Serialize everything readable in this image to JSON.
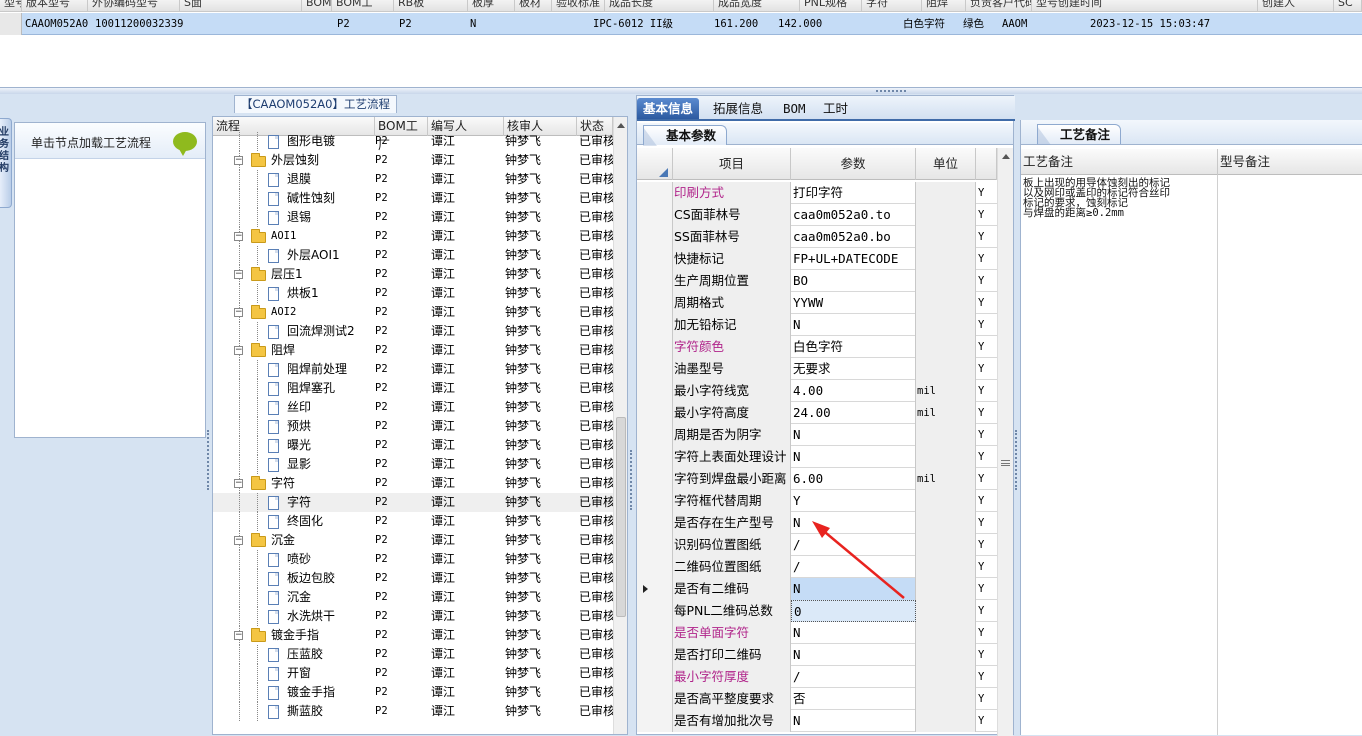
{
  "top_grid": {
    "header_cols": [
      "型号",
      "版本型号",
      "外协编码型号",
      "S面",
      "BOM工厂",
      "BOM工",
      "RB板",
      "板厚",
      "板材",
      "验收标准",
      "成品长度",
      "成品宽度",
      "PNL规格",
      "字符",
      "阻焊",
      "负责客户代码",
      "型号创建时间",
      "创建人",
      "SC"
    ],
    "row": [
      "CAAOM052A0",
      "10011200032339",
      "P2",
      "P2",
      "N",
      "IPC-6012 II级",
      "161.200",
      "142.000",
      "白色字符",
      "绿色",
      "AAOM",
      "2023-12-15 15:03:47"
    ]
  },
  "side_tab": "业务结构",
  "left_panel": {
    "hint": "单击节点加载工艺流程"
  },
  "process_panel": {
    "title": "【CAAOM052A0】工艺流程",
    "headers": [
      "流程",
      "BOM工厂",
      "编写人",
      "核审人",
      "状态"
    ],
    "rows": [
      {
        "name": "图形电镀",
        "level": 1,
        "bom": "P2",
        "writer": "谭江",
        "reviewer": "钟梦飞",
        "status": "已审核"
      },
      {
        "name": "外层蚀刻",
        "level": 0,
        "bom": "P2",
        "writer": "谭江",
        "reviewer": "钟梦飞",
        "status": "已审核"
      },
      {
        "name": "退膜",
        "level": 1,
        "bom": "P2",
        "writer": "谭江",
        "reviewer": "钟梦飞",
        "status": "已审核"
      },
      {
        "name": "碱性蚀刻",
        "level": 1,
        "bom": "P2",
        "writer": "谭江",
        "reviewer": "钟梦飞",
        "status": "已审核"
      },
      {
        "name": "退锡",
        "level": 1,
        "bom": "P2",
        "writer": "谭江",
        "reviewer": "钟梦飞",
        "status": "已审核"
      },
      {
        "name": "AOI1",
        "level": 0,
        "bom": "P2",
        "writer": "谭江",
        "reviewer": "钟梦飞",
        "status": "已审核"
      },
      {
        "name": "外层AOI1",
        "level": 1,
        "bom": "P2",
        "writer": "谭江",
        "reviewer": "钟梦飞",
        "status": "已审核"
      },
      {
        "name": "层压1",
        "level": 0,
        "bom": "P2",
        "writer": "谭江",
        "reviewer": "钟梦飞",
        "status": "已审核"
      },
      {
        "name": "烘板1",
        "level": 1,
        "bom": "P2",
        "writer": "谭江",
        "reviewer": "钟梦飞",
        "status": "已审核"
      },
      {
        "name": "AOI2",
        "level": 0,
        "bom": "P2",
        "writer": "谭江",
        "reviewer": "钟梦飞",
        "status": "已审核"
      },
      {
        "name": "回流焊测试2",
        "level": 1,
        "bom": "P2",
        "writer": "谭江",
        "reviewer": "钟梦飞",
        "status": "已审核"
      },
      {
        "name": "阻焊",
        "level": 0,
        "bom": "P2",
        "writer": "谭江",
        "reviewer": "钟梦飞",
        "status": "已审核"
      },
      {
        "name": "阻焊前处理",
        "level": 1,
        "bom": "P2",
        "writer": "谭江",
        "reviewer": "钟梦飞",
        "status": "已审核"
      },
      {
        "name": "阻焊塞孔",
        "level": 1,
        "bom": "P2",
        "writer": "谭江",
        "reviewer": "钟梦飞",
        "status": "已审核"
      },
      {
        "name": "丝印",
        "level": 1,
        "bom": "P2",
        "writer": "谭江",
        "reviewer": "钟梦飞",
        "status": "已审核"
      },
      {
        "name": "预烘",
        "level": 1,
        "bom": "P2",
        "writer": "谭江",
        "reviewer": "钟梦飞",
        "status": "已审核"
      },
      {
        "name": "曝光",
        "level": 1,
        "bom": "P2",
        "writer": "谭江",
        "reviewer": "钟梦飞",
        "status": "已审核"
      },
      {
        "name": "显影",
        "level": 1,
        "bom": "P2",
        "writer": "谭江",
        "reviewer": "钟梦飞",
        "status": "已审核"
      },
      {
        "name": "字符",
        "level": 0,
        "bom": "P2",
        "writer": "谭江",
        "reviewer": "钟梦飞",
        "status": "已审核"
      },
      {
        "name": "字符",
        "level": 1,
        "bom": "P2",
        "writer": "谭江",
        "reviewer": "钟梦飞",
        "status": "已审核",
        "highlight": true
      },
      {
        "name": "终固化",
        "level": 1,
        "bom": "P2",
        "writer": "谭江",
        "reviewer": "钟梦飞",
        "status": "已审核"
      },
      {
        "name": "沉金",
        "level": 0,
        "bom": "P2",
        "writer": "谭江",
        "reviewer": "钟梦飞",
        "status": "已审核"
      },
      {
        "name": "喷砂",
        "level": 1,
        "bom": "P2",
        "writer": "谭江",
        "reviewer": "钟梦飞",
        "status": "已审核"
      },
      {
        "name": "板边包胶",
        "level": 1,
        "bom": "P2",
        "writer": "谭江",
        "reviewer": "钟梦飞",
        "status": "已审核"
      },
      {
        "name": "沉金",
        "level": 1,
        "bom": "P2",
        "writer": "谭江",
        "reviewer": "钟梦飞",
        "status": "已审核"
      },
      {
        "name": "水洗烘干",
        "level": 1,
        "bom": "P2",
        "writer": "谭江",
        "reviewer": "钟梦飞",
        "status": "已审核"
      },
      {
        "name": "镀金手指",
        "level": 0,
        "bom": "P2",
        "writer": "谭江",
        "reviewer": "钟梦飞",
        "status": "已审核"
      },
      {
        "name": "压蓝胶",
        "level": 1,
        "bom": "P2",
        "writer": "谭江",
        "reviewer": "钟梦飞",
        "status": "已审核"
      },
      {
        "name": "开窗",
        "level": 1,
        "bom": "P2",
        "writer": "谭江",
        "reviewer": "钟梦飞",
        "status": "已审核"
      },
      {
        "name": "镀金手指",
        "level": 1,
        "bom": "P2",
        "writer": "谭江",
        "reviewer": "钟梦飞",
        "status": "已审核"
      },
      {
        "name": "撕蓝胶",
        "level": 1,
        "bom": "P2",
        "writer": "谭江",
        "reviewer": "钟梦飞",
        "status": "已审核"
      }
    ]
  },
  "mid_panel": {
    "tabs": [
      "基本信息",
      "拓展信息",
      "BOM",
      "工时"
    ],
    "subtab": "基本参数",
    "headers": [
      "项目",
      "参数",
      "单位"
    ],
    "rows": [
      {
        "k": "印刷方式",
        "v": "打印字符",
        "u": "",
        "f": "Y",
        "pink": true
      },
      {
        "k": "CS面菲林号",
        "v": "caa0m052a0.to",
        "u": "",
        "f": "Y"
      },
      {
        "k": "SS面菲林号",
        "v": "caa0m052a0.bo",
        "u": "",
        "f": "Y"
      },
      {
        "k": "快捷标记",
        "v": "FP+UL+DATECODE",
        "u": "",
        "f": "Y"
      },
      {
        "k": "生产周期位置",
        "v": "BO",
        "u": "",
        "f": "Y"
      },
      {
        "k": "周期格式",
        "v": "YYWW",
        "u": "",
        "f": "Y"
      },
      {
        "k": "加无铅标记",
        "v": "N",
        "u": "",
        "f": "Y"
      },
      {
        "k": "字符颜色",
        "v": "白色字符",
        "u": "",
        "f": "Y",
        "pink": true
      },
      {
        "k": "油墨型号",
        "v": "无要求",
        "u": "",
        "f": "Y"
      },
      {
        "k": "最小字符线宽",
        "v": "4.00",
        "u": "mil",
        "f": "Y"
      },
      {
        "k": "最小字符高度",
        "v": "24.00",
        "u": "mil",
        "f": "Y"
      },
      {
        "k": "周期是否为阴字",
        "v": "N",
        "u": "",
        "f": "Y"
      },
      {
        "k": "字符上表面处理设计",
        "v": "N",
        "u": "",
        "f": "Y"
      },
      {
        "k": "字符到焊盘最小距离",
        "v": "6.00",
        "u": "mil",
        "f": "Y"
      },
      {
        "k": "字符框代替周期",
        "v": "Y",
        "u": "",
        "f": "Y"
      },
      {
        "k": "是否存在生产型号",
        "v": "N",
        "u": "",
        "f": "Y"
      },
      {
        "k": "识别码位置图纸",
        "v": "/",
        "u": "",
        "f": "Y"
      },
      {
        "k": "二维码位置图纸",
        "v": "/",
        "u": "",
        "f": "Y"
      },
      {
        "k": "是否有二维码",
        "v": "N",
        "u": "",
        "f": "Y",
        "cur": true,
        "sel": 1
      },
      {
        "k": "每PNL二维码总数",
        "v": "0",
        "u": "",
        "f": "Y",
        "sel": 2
      },
      {
        "k": "是否单面字符",
        "v": "N",
        "u": "",
        "f": "Y",
        "pink": true
      },
      {
        "k": "是否打印二维码",
        "v": "N",
        "u": "",
        "f": "Y"
      },
      {
        "k": "最小字符厚度",
        "v": "/",
        "u": "",
        "f": "Y",
        "pink": true
      },
      {
        "k": "是否高平整度要求",
        "v": "否",
        "u": "",
        "f": "Y"
      },
      {
        "k": "是否有增加批次号",
        "v": "N",
        "u": "",
        "f": "Y"
      }
    ]
  },
  "right_panel": {
    "subtab": "工艺备注",
    "headers": [
      "工艺备注",
      "型号备注"
    ],
    "note": "板上出现的用导体蚀刻出的标记\n以及网印或盖印的标记符合丝印\n标记的要求，蚀刻标记\n与焊盘的距离≥0.2mm"
  },
  "colors": {
    "accent": "#2c5aa0",
    "pink_label": "#b0238a",
    "selected_row": "#c5dcf6",
    "arrow": "#e8231f"
  }
}
